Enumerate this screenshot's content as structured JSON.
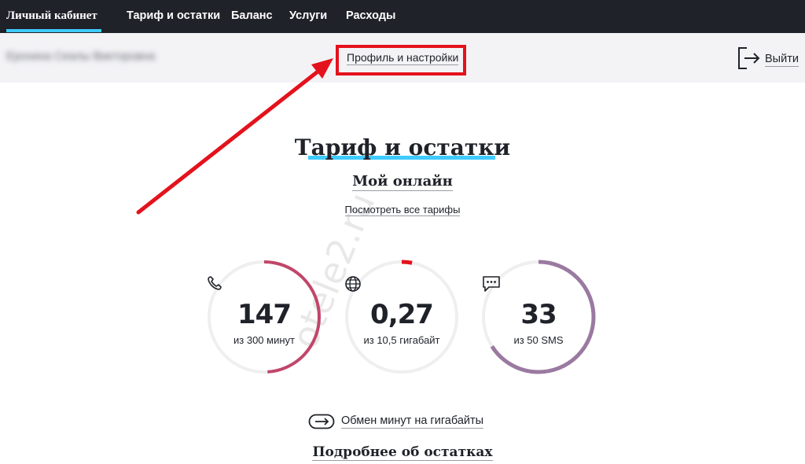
{
  "nav": {
    "items": [
      {
        "label": "Личный кабинет",
        "active": true
      },
      {
        "label": "Тариф и остатки"
      },
      {
        "label": "Баланс"
      },
      {
        "label": "Услуги"
      },
      {
        "label": "Расходы"
      }
    ]
  },
  "subbar": {
    "user_name": "Ерохина Сеалы Викторовна",
    "profile_link": "Профиль и настройки",
    "exit_label": "Выйти"
  },
  "main": {
    "title": "Тариф и остатки",
    "tariff_name": "Мой онлайн",
    "all_tariffs_link": "Посмотреть все тарифы",
    "gauges": [
      {
        "icon": "phone-icon",
        "value": "147",
        "caption": "из 300 минут",
        "remaining": 147,
        "total": 300,
        "color": "#c0476a"
      },
      {
        "icon": "globe-icon",
        "value": "0,27",
        "caption": "из 10,5 гигабайт",
        "remaining": 0.27,
        "total": 10.5,
        "color": "#e4121c"
      },
      {
        "icon": "message-icon",
        "value": "33",
        "caption": "из 50 SMS",
        "remaining": 33,
        "total": 50,
        "color": "#9a7aa0"
      }
    ],
    "exchange_link": "Обмен минут на гигабайты",
    "details_link": "Подробнее об остатках"
  },
  "watermark": "otele2.ru",
  "colors": {
    "nav_bg": "#1f2229",
    "accent": "#3fcbff",
    "highlight_red": "#e4121c",
    "track": "#efefef"
  }
}
